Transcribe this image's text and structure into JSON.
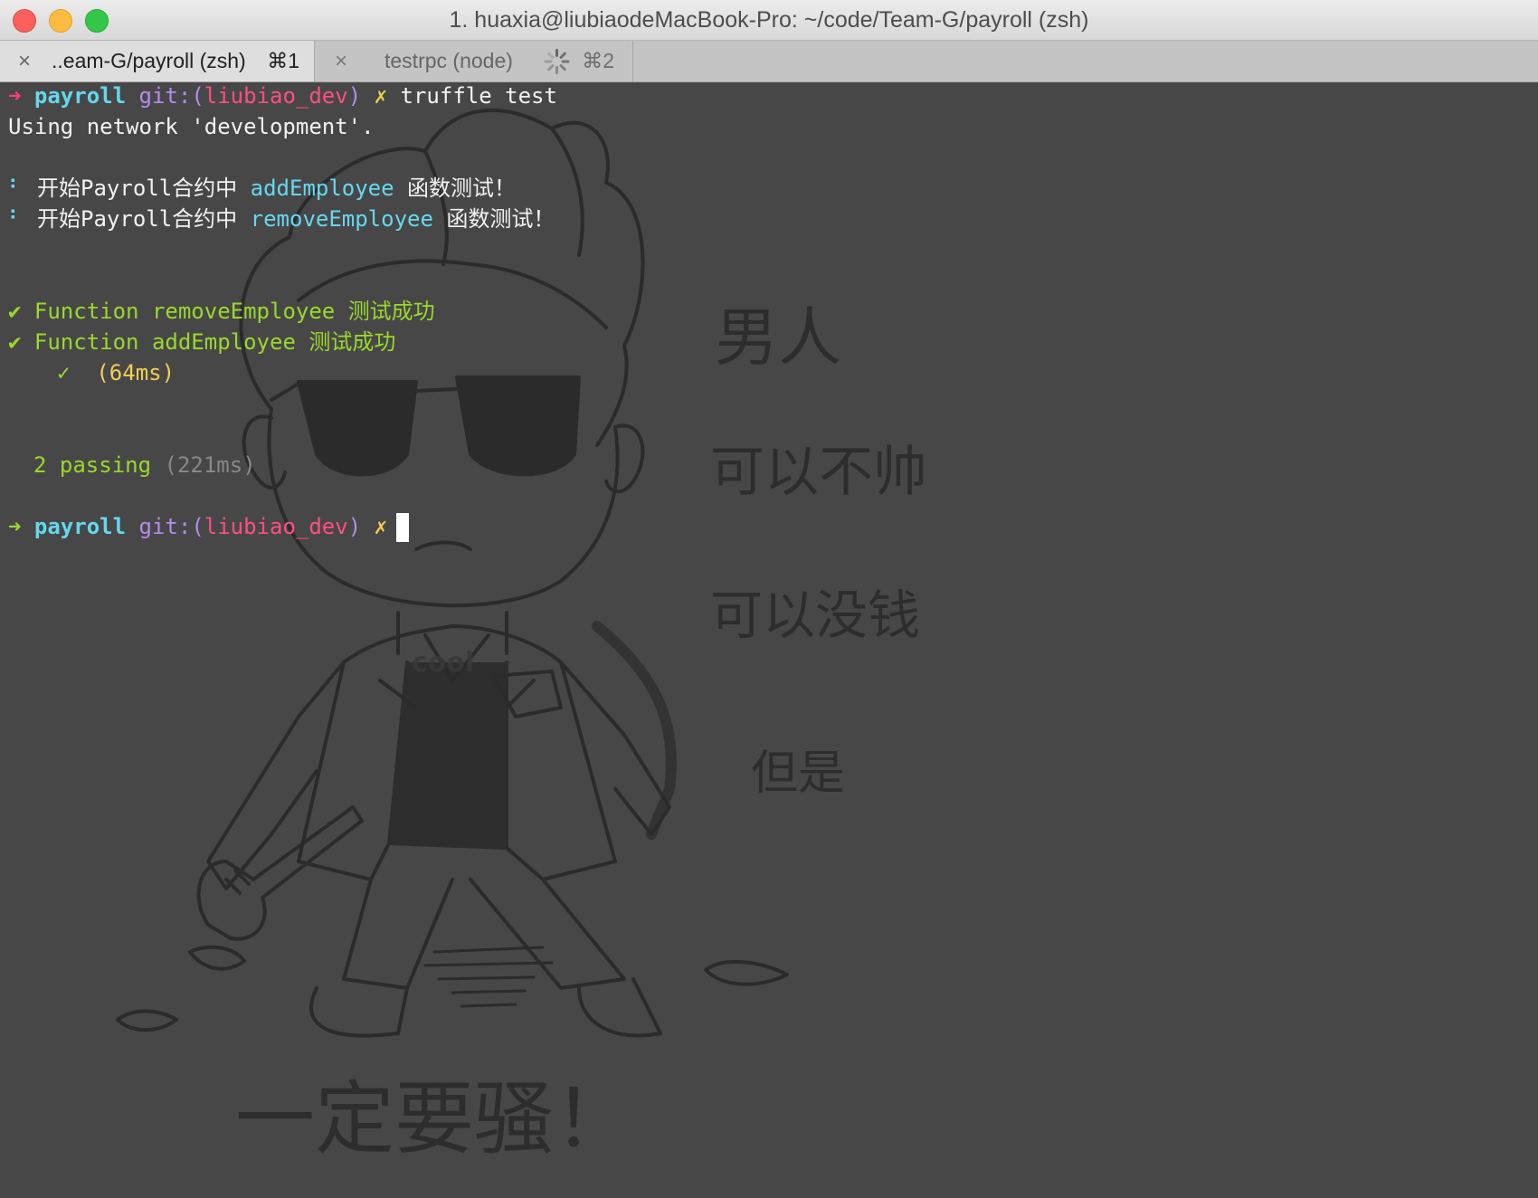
{
  "window": {
    "title": "1. huaxia@liubiaodeMacBook-Pro: ~/code/Team-G/payroll (zsh)"
  },
  "tabs": [
    {
      "close": "×",
      "label": "..eam-G/payroll (zsh)",
      "shortcut": "⌘1"
    },
    {
      "close": "×",
      "label": "testrpc (node)",
      "shortcut": "⌘2"
    }
  ],
  "terminal": {
    "prompt_arrow": "➜",
    "cwd": "payroll",
    "git_prefix": "git:(",
    "branch": "liubiao_dev",
    "git_suffix": ")",
    "dirty": "✗",
    "command": "truffle test",
    "network_line": "Using network 'development'.",
    "spinner_dots": "⠃",
    "start_prefix": "开始Payroll合约中",
    "fn_add": "addEmployee",
    "fn_remove": "removeEmployee",
    "start_suffix": "函数测试！",
    "check": "✔",
    "pass_remove": "Function removeEmployee 测试成功",
    "pass_add": "Function addEmployee 测试成功",
    "sub_check": "✓",
    "timing": "(64ms)",
    "passing": "2 passing",
    "passing_time": "(221ms)"
  },
  "artwork": {
    "shirt_text": "cool",
    "line1": "男人",
    "line2": "可以不帅",
    "line3": "可以没钱",
    "line4": "但是",
    "line5": "一定要骚！"
  },
  "colors": {
    "background": "#474747",
    "prompt_red": "#ff3f72",
    "prompt_green": "#9ad82b",
    "cwd": "#64d8ee",
    "branch": "#ff4f7f",
    "git": "#b58bf0",
    "dirty": "#f1cf53"
  }
}
